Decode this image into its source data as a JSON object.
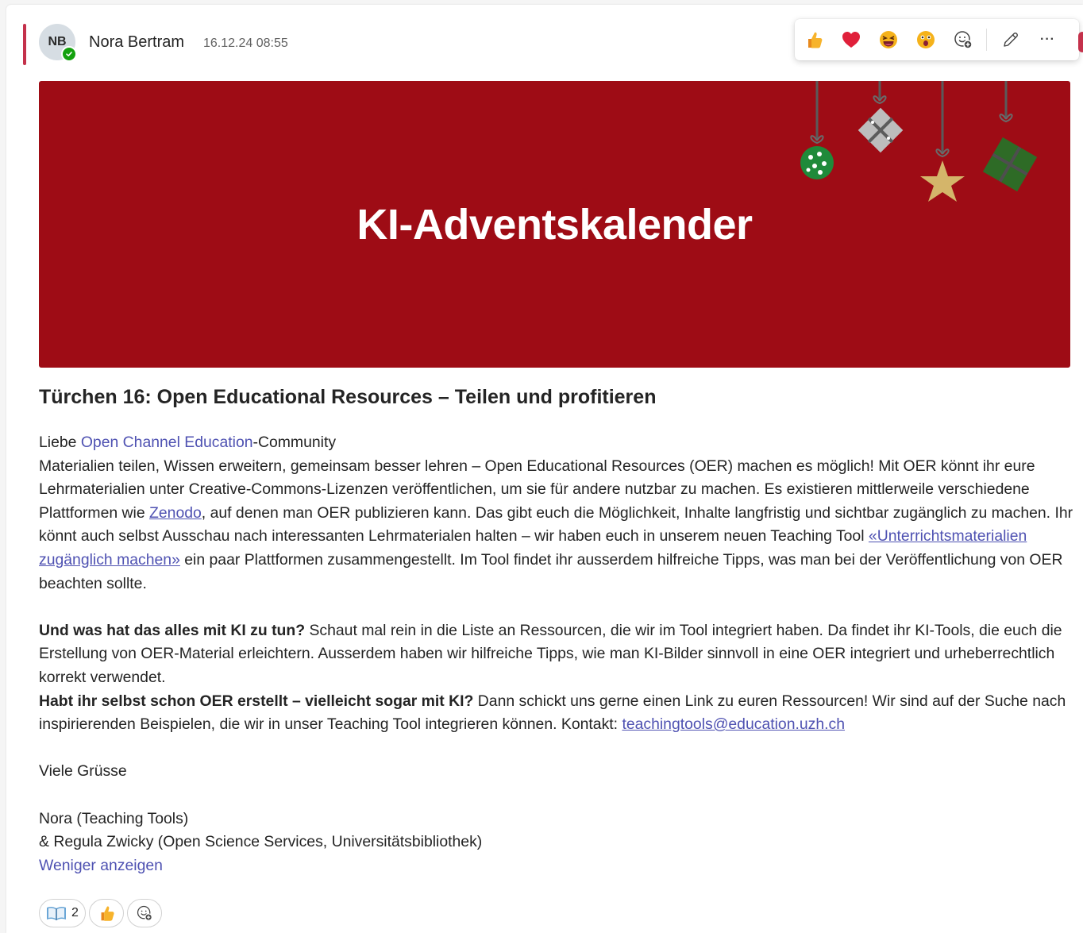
{
  "message": {
    "avatar_initials": "NB",
    "author": "Nora Bertram",
    "timestamp": "16.12.24 08:55"
  },
  "toolbar": {
    "reactions": [
      "thumbs-up",
      "heart",
      "laughing",
      "surprised",
      "add-reaction"
    ],
    "edit": "pencil-icon",
    "more": "···"
  },
  "banner": {
    "title": "KI-Adventskalender",
    "background_color": "#9e0c15"
  },
  "post": {
    "heading": "Türchen 16: Open Educational Resources – Teilen und profitieren",
    "greeting_prefix": "Liebe ",
    "greeting_mention": "Open Channel Education",
    "greeting_suffix": "-Community",
    "p1_part1": "Materialien teilen, Wissen erweitern, gemeinsam besser lehren – Open Educational Resources (OER) machen es möglich! Mit OER könnt ihr eure Lehrmaterialien unter Creative-Commons-Lizenzen veröffentlichen, um sie für andere nutzbar zu machen. Es existieren mittlerweile verschiedene Plattformen wie ",
    "p1_link1": "Zenodo",
    "p1_part2": ", auf denen man OER publizieren kann. Das gibt euch die Möglichkeit, Inhalte langfristig und sichtbar zugänglich zu machen. Ihr könnt auch selbst Ausschau nach interessanten Lehrmaterialen halten – wir haben euch in unserem neuen Teaching Tool ",
    "p1_link2": "«Unterrichtsmaterialien zugänglich machen»",
    "p1_part3": " ein paar Plattformen zusammengestellt. Im Tool findet ihr ausserdem hilfreiche Tipps, was man bei der Veröffentlichung von OER beachten sollte.",
    "p2_bold": "Und was hat das alles mit KI zu tun?",
    "p2_text": " Schaut mal rein in die Liste an Ressourcen, die wir im Tool integriert haben. Da findet ihr KI-Tools, die euch die Erstellung von OER-Material erleichtern. Ausserdem haben wir hilfreiche Tipps, wie man KI-Bilder sinnvoll in eine OER integriert und urheberrechtlich korrekt verwendet.",
    "p3_bold": "Habt ihr selbst schon OER erstellt – vielleicht sogar mit KI?",
    "p3_text": " Dann schickt uns gerne einen Link zu euren Ressourcen! Wir sind auf der Suche nach inspirierenden Beispielen, die wir in unser Teaching Tool integrieren können. Kontakt: ",
    "p3_email": "teachingtools@education.uzh.ch",
    "closing": "Viele Grüsse",
    "signature_line1": "Nora (Teaching Tools)",
    "signature_line2": "& Regula Zwicky (Open Science Services, Universitätsbibliothek)",
    "show_less": "Weniger anzeigen"
  },
  "reactions_bar": {
    "book_count": "2"
  },
  "colors": {
    "accent": "#c4314b",
    "link": "#4f52b2",
    "presence": "#13a10e"
  }
}
